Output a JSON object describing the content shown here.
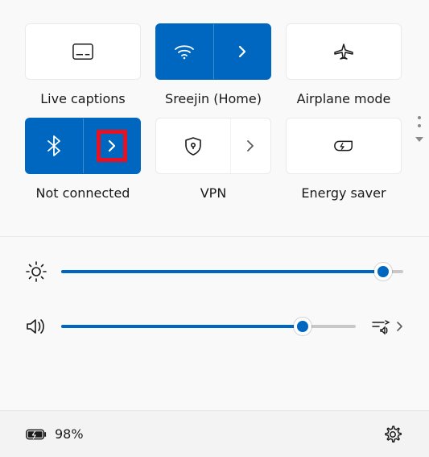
{
  "colors": {
    "accent": "#0067c0",
    "highlight": "#e81123"
  },
  "tiles": [
    {
      "id": "live-captions",
      "label": "Live captions",
      "active": false,
      "split": false,
      "icon": "captions-icon"
    },
    {
      "id": "wifi",
      "label": "Sreejin (Home)",
      "active": true,
      "split": true,
      "icon": "wifi-icon"
    },
    {
      "id": "airplane",
      "label": "Airplane mode",
      "active": false,
      "split": false,
      "icon": "airplane-icon"
    },
    {
      "id": "bluetooth",
      "label": "Not connected",
      "active": true,
      "split": true,
      "icon": "bluetooth-icon",
      "highlighted_chevron": true
    },
    {
      "id": "vpn",
      "label": "VPN",
      "active": false,
      "split": true,
      "icon": "vpn-icon"
    },
    {
      "id": "energy-saver",
      "label": "Energy saver",
      "active": false,
      "split": false,
      "icon": "energy-saver-icon"
    }
  ],
  "sliders": {
    "brightness": {
      "value": 94
    },
    "volume": {
      "value": 82
    }
  },
  "battery": {
    "percent_label": "98%"
  }
}
